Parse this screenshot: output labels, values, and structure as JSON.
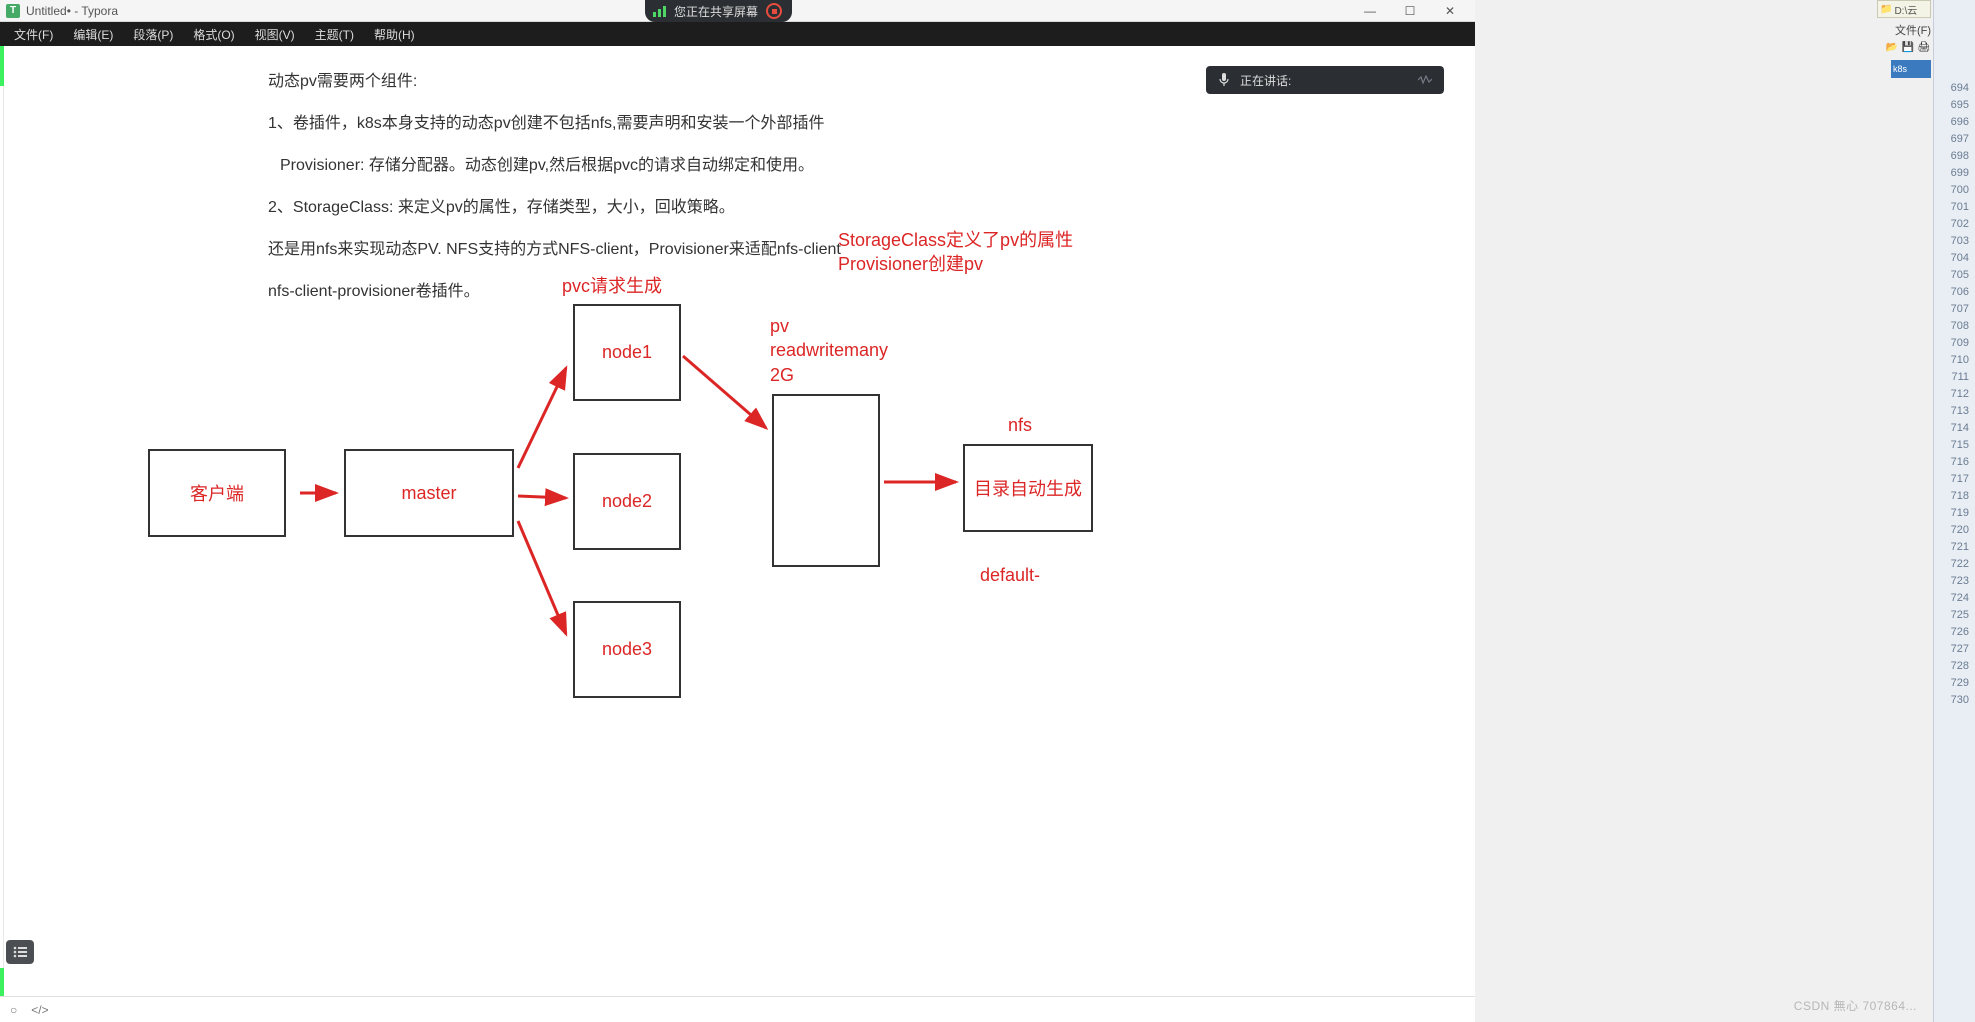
{
  "window": {
    "title": "Untitled• - Typora",
    "min": "—",
    "max": "☐",
    "close": "✕"
  },
  "menubar": [
    "文件(F)",
    "编辑(E)",
    "段落(P)",
    "格式(O)",
    "视图(V)",
    "主题(T)",
    "帮助(H)"
  ],
  "share_bar": {
    "text": "您正在共享屏幕"
  },
  "speaking_bar": {
    "text": "正在讲话:"
  },
  "paragraphs": {
    "p1": "动态pv需要两个组件:",
    "p2": "1、卷插件，k8s本身支持的动态pv创建不包括nfs,需要声明和安装一个外部插件",
    "p3": "Provisioner: 存储分配器。动态创建pv,然后根据pvc的请求自动绑定和使用。",
    "p4": "2、StorageClass: 来定义pv的属性，存储类型，大小，回收策略。",
    "p5": "还是用nfs来实现动态PV. NFS支持的方式NFS-client，Provisioner来适配nfs-client",
    "p6": "nfs-client-provisioner卷插件。"
  },
  "diagram": {
    "client": "客户端",
    "master": "master",
    "node1": "node1",
    "node2": "node2",
    "node3": "node3",
    "box_nfs": "目录自动生成",
    "pvc_label": "pvc请求生成",
    "pv_label": "pv\nreadwritemany\n2G",
    "storageclass_label": "StorageClass定义了pv的属性\nProvisioner创建pv",
    "nfs_label": "nfs",
    "default_label": "default-"
  },
  "statusbar": {
    "circle": "○",
    "code": "</>"
  },
  "side": {
    "tag_text": "D:\\云",
    "menu": "文件(F)",
    "app_label": "k8s",
    "line_start": 694,
    "line_end": 730
  },
  "watermark": "CSDN 無心 707864..."
}
